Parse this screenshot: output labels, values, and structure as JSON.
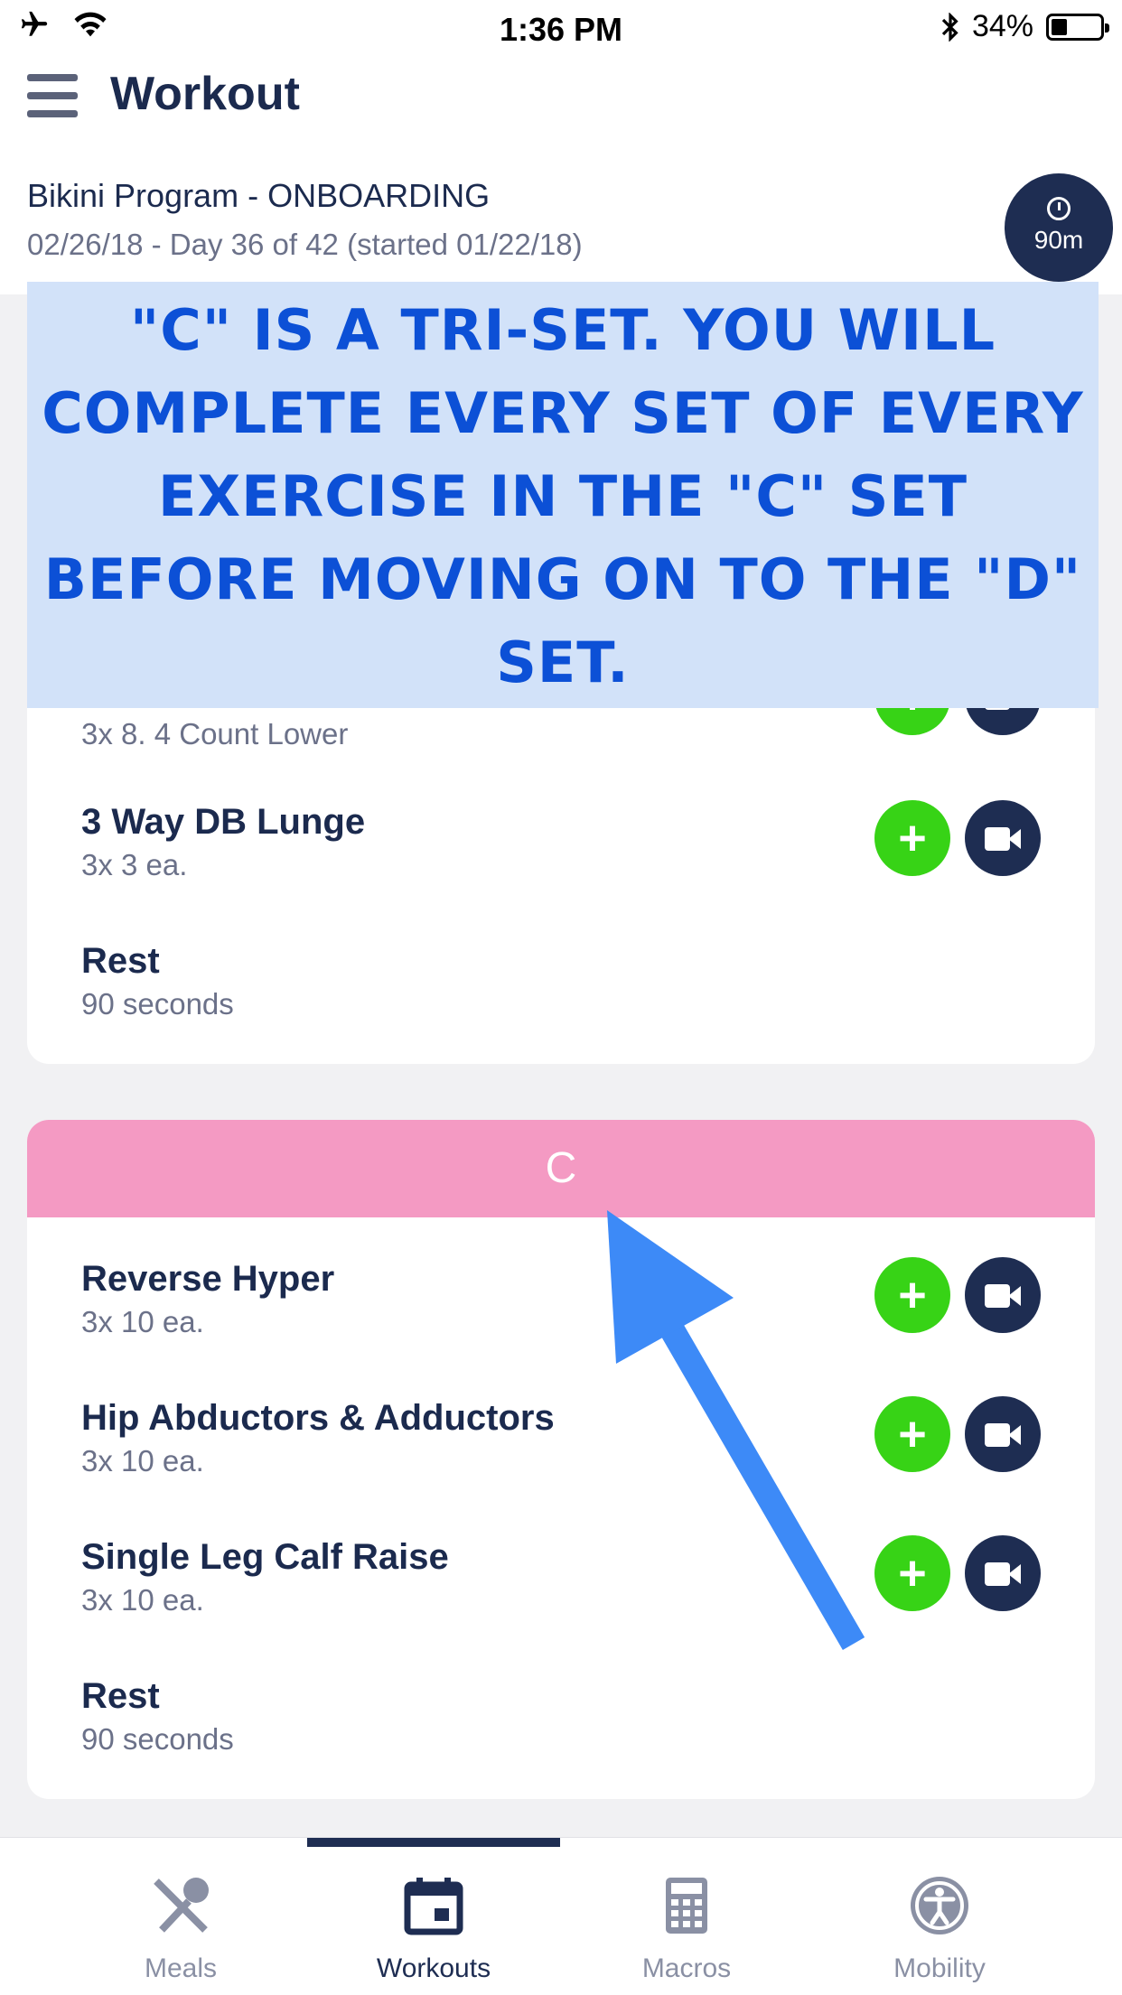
{
  "status_bar": {
    "time": "1:36 PM",
    "battery": "34%"
  },
  "header": {
    "title": "Workout",
    "program": "Bikini Program - ONBOARDING",
    "date_line": "02/26/18 - Day 36 of 42 (started 01/22/18)",
    "timer_label": "90m"
  },
  "overlay_note": "\"C\" is a tri-set. You will complete every set of every exercise in the \"C\" set before moving on to the \"D\" set.",
  "group_b": {
    "items": [
      {
        "detail": "3x 8. 4 Count Lower"
      },
      {
        "name": "3 Way DB Lunge",
        "detail": "3x 3 ea."
      },
      {
        "name": "Rest",
        "detail": "90 seconds"
      }
    ]
  },
  "group_c": {
    "label": "C",
    "items": [
      {
        "name": "Reverse Hyper",
        "detail": "3x 10 ea."
      },
      {
        "name": "Hip Abductors & Adductors",
        "detail": "3x 10 ea."
      },
      {
        "name": "Single Leg Calf Raise",
        "detail": "3x 10 ea."
      },
      {
        "name": "Rest",
        "detail": "90 seconds"
      }
    ]
  },
  "tabs": [
    {
      "label": "Meals",
      "icon": "utensils-icon"
    },
    {
      "label": "Workouts",
      "icon": "calendar-icon",
      "active": true
    },
    {
      "label": "Macros",
      "icon": "calculator-icon"
    },
    {
      "label": "Mobility",
      "icon": "accessibility-icon"
    }
  ],
  "colors": {
    "navy": "#1e2d52",
    "add_green": "#37d316",
    "group_c_header": "#f49ac3",
    "overlay_bg": "#d2e2f9",
    "overlay_text": "#0c50d6",
    "arrow": "#3d8af7"
  }
}
